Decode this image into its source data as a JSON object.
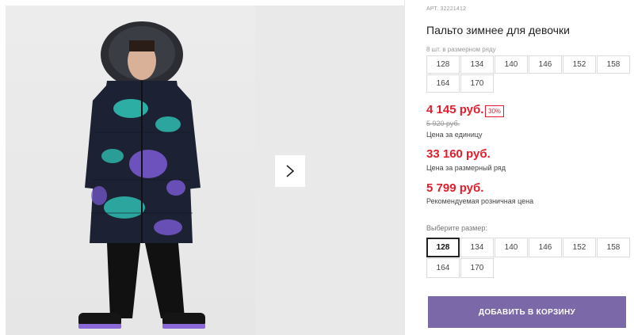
{
  "product": {
    "article": "АРТ. 32221412",
    "title": "Пальто зимнее для девочки",
    "row_label": "8 шт. в размерном ряду",
    "row_sizes": [
      "128",
      "134",
      "140",
      "146",
      "152",
      "158",
      "164",
      "170"
    ],
    "price": "4 145 руб.",
    "discount": "30%",
    "old_price": "5 920 руб.",
    "unit_label": "Цена за единицу",
    "row_price": "33 160 руб.",
    "row_price_label": "Цена за размерный ряд",
    "retail_price": "5 799 руб.",
    "retail_label": "Рекомендуемая розничная цена",
    "choose_label": "Выберите размер:",
    "choose_sizes": [
      "128",
      "134",
      "140",
      "146",
      "152",
      "158",
      "164",
      "170"
    ],
    "selected_size": "128",
    "cart_button": "ДОБАВИТЬ В КОРЗИНУ"
  },
  "gallery": {
    "next_icon": "chevron-right-icon"
  },
  "colors": {
    "accent": "#7a68a9",
    "sale": "#e11d2b"
  }
}
